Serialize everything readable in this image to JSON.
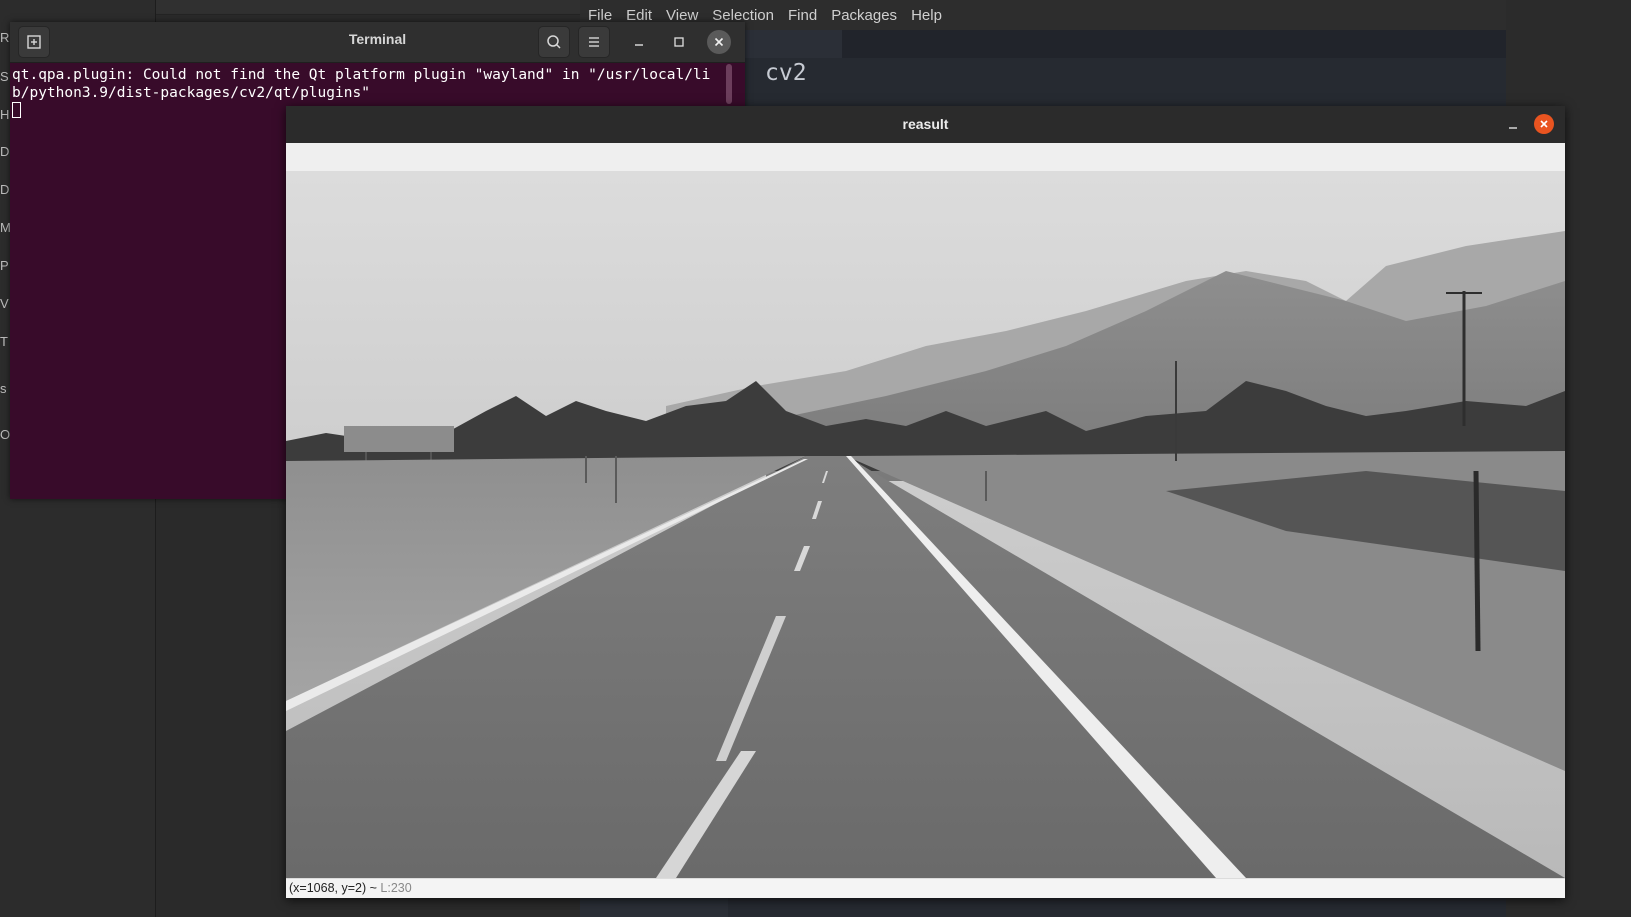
{
  "background": {
    "file_manager_letters": [
      "R",
      "S",
      "H",
      "D",
      "D",
      "M",
      "P",
      "V",
      "T",
      "s",
      "O"
    ],
    "editor": {
      "menu": [
        "File",
        "Edit",
        "View",
        "Selection",
        "Find",
        "Packages",
        "Help"
      ],
      "code_fragment": "cv2"
    }
  },
  "terminal": {
    "title": "Terminal",
    "output_lines": [
      "qt.qpa.plugin: Could not find the Qt platform plugin \"wayland\" in \"/usr/local/li",
      "b/python3.9/dist-packages/cv2/qt/plugins\""
    ],
    "icons": {
      "new_tab": "new-tab-icon",
      "search": "search-icon",
      "menu": "hamburger-menu-icon",
      "minimize": "minimize-icon",
      "maximize": "maximize-icon",
      "close": "close-icon"
    }
  },
  "result_window": {
    "title": "reasult",
    "status_coords": "(x=1068, y=2) ~ ",
    "status_value": "L:230",
    "image_description_colors": {
      "sky": "#cfcfcf",
      "hills": "#8a8a8a",
      "road": "#6e6e6e",
      "field": "#9a9a9a"
    }
  },
  "colors": {
    "terminal_bg": "#380b2a",
    "titlebar": "#2b2b2b",
    "close_accent": "#e95420",
    "editor_bg": "#262a31"
  }
}
